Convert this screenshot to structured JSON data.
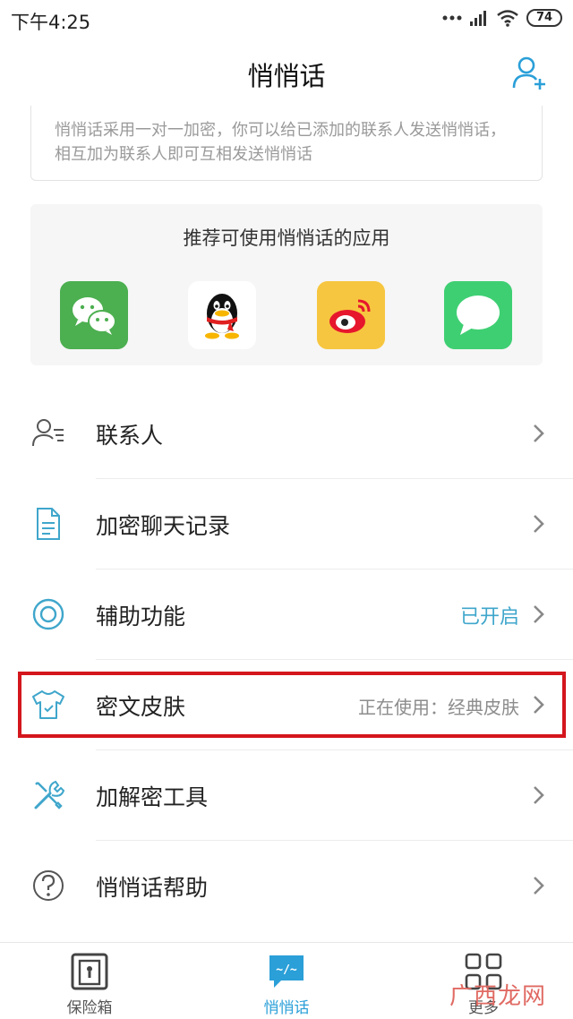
{
  "status_bar": {
    "time": "下午4:25",
    "battery": "74"
  },
  "header": {
    "title": "悄悄话"
  },
  "notice": {
    "text": "悄悄话采用一对一加密，你可以给已添加的联系人发送悄悄话，相互加为联系人即可互相发送悄悄话"
  },
  "recommend": {
    "title": "推荐可使用悄悄话的应用",
    "apps": [
      "wechat-icon",
      "qq-icon",
      "weibo-icon",
      "messages-icon"
    ]
  },
  "menu": {
    "items": [
      {
        "label": "联系人",
        "value": "",
        "icon": "contacts-icon"
      },
      {
        "label": "加密聊天记录",
        "value": "",
        "icon": "document-icon"
      },
      {
        "label": "辅助功能",
        "value": "已开启",
        "icon": "target-icon"
      },
      {
        "label": "密文皮肤",
        "value": "正在使用：经典皮肤",
        "icon": "shirt-icon"
      },
      {
        "label": "加解密工具",
        "value": "",
        "icon": "tools-icon"
      },
      {
        "label": "悄悄话帮助",
        "value": "",
        "icon": "help-icon"
      }
    ]
  },
  "tabs": {
    "vault": "保险箱",
    "whisper": "悄悄话",
    "more": "更多"
  },
  "watermark": "广西龙网",
  "colors": {
    "accent": "#2a9fd8",
    "enabled": "#3fa6cb",
    "highlight": "#d4161d"
  }
}
